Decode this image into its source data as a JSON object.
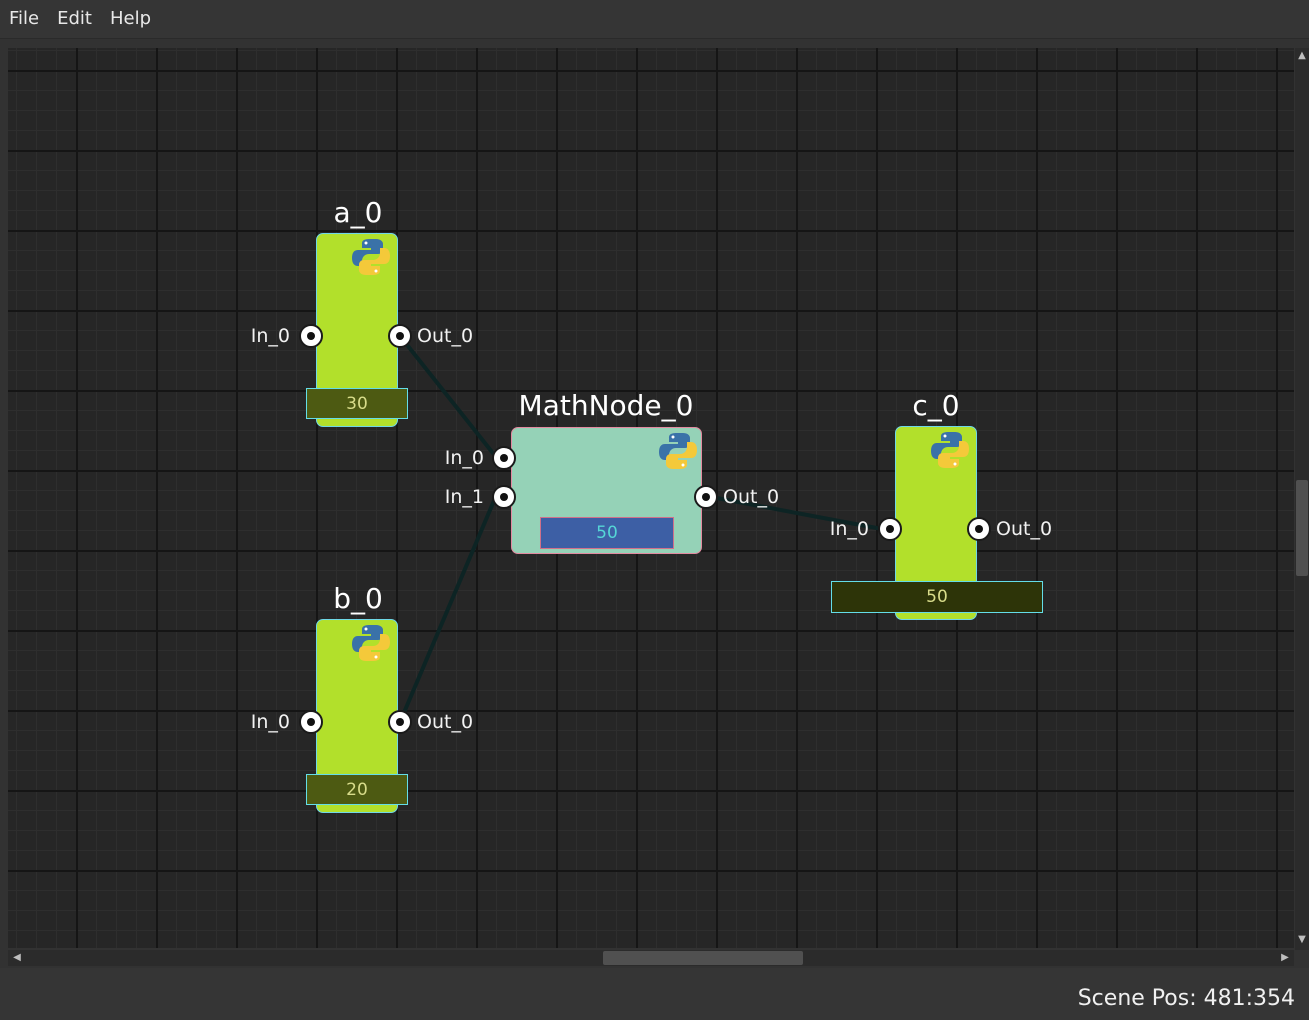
{
  "menu": {
    "file": "File",
    "edit": "Edit",
    "help": "Help"
  },
  "nodes": {
    "a": {
      "title": "a_0",
      "in_label": "In_0",
      "out_label": "Out_0",
      "value": "30"
    },
    "b": {
      "title": "b_0",
      "in_label": "In_0",
      "out_label": "Out_0",
      "value": "20"
    },
    "math": {
      "title": "MathNode_0",
      "in0_label": "In_0",
      "in1_label": "In_1",
      "out_label": "Out_0",
      "value": "50"
    },
    "c": {
      "title": "c_0",
      "in_label": "In_0",
      "out_label": "Out_0",
      "value": "50"
    }
  },
  "status": {
    "scene_pos": "Scene Pos: 481:354"
  },
  "colors": {
    "node_green": "#b2e02b",
    "math_node": "#95d2b7",
    "edge": "#0d2424",
    "canvas_bg": "#262626"
  },
  "icons": {
    "node_icon": "python-logo-icon"
  }
}
